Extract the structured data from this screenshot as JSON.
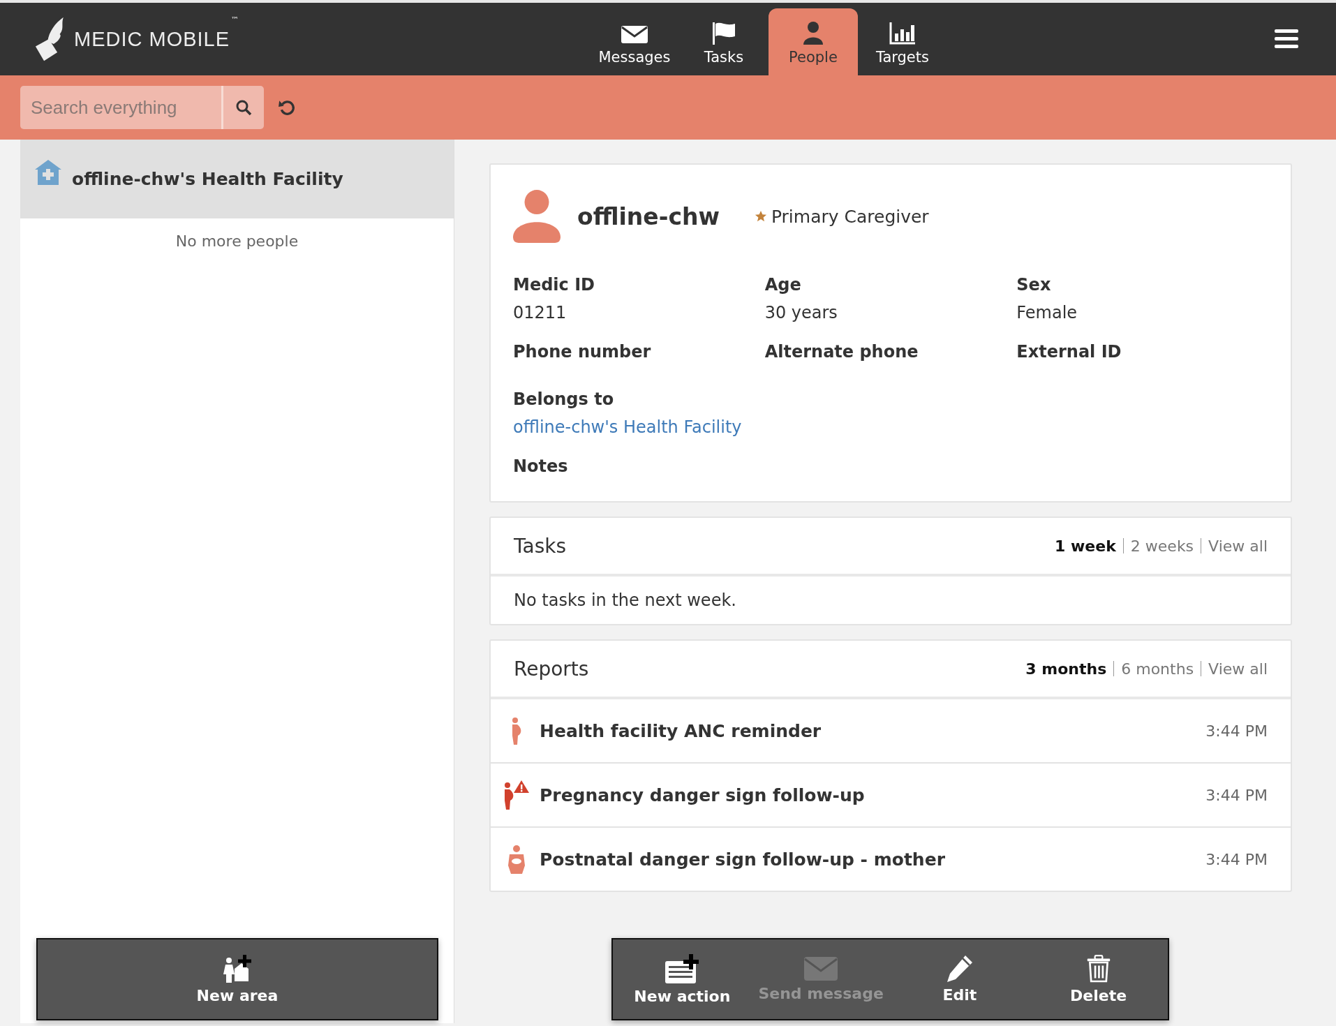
{
  "brand": {
    "name": "MEDIC MOBILE",
    "mark": "™"
  },
  "nav": [
    {
      "label": "Messages",
      "selected": false
    },
    {
      "label": "Tasks",
      "selected": false
    },
    {
      "label": "People",
      "selected": true
    },
    {
      "label": "Targets",
      "selected": false
    }
  ],
  "search": {
    "placeholder": "Search everything"
  },
  "left_panel": {
    "place": {
      "name": "offline-chw's Health Facility",
      "selected": true
    },
    "empty_note": "No more people",
    "actions": [
      {
        "label": "New area",
        "disabled": false
      }
    ]
  },
  "contact": {
    "name": "offline-chw",
    "role": "Primary Caregiver",
    "fields": [
      {
        "label": "Medic ID",
        "value": "01211"
      },
      {
        "label": "Age",
        "value": "30 years"
      },
      {
        "label": "Sex",
        "value": "Female"
      },
      {
        "label": "Phone number"
      },
      {
        "label": "Alternate phone"
      },
      {
        "label": "External ID"
      }
    ],
    "belongs_to": {
      "label": "Belongs to",
      "link": "offline-chw's Health Facility"
    },
    "notes": {
      "label": "Notes"
    }
  },
  "tasks": {
    "title": "Tasks",
    "filters": [
      {
        "label": "1 week",
        "selected": true
      },
      {
        "label": "2 weeks",
        "selected": false
      },
      {
        "label": "View all",
        "selected": false
      }
    ],
    "empty": "No tasks in the next week."
  },
  "reports": {
    "title": "Reports",
    "filters": [
      {
        "label": "3 months",
        "selected": true
      },
      {
        "label": "6 months",
        "selected": false
      },
      {
        "label": "View all",
        "selected": false
      }
    ],
    "items": [
      {
        "title": "Health facility ANC reminder",
        "time": "3:44 PM"
      },
      {
        "title": "Pregnancy danger sign follow-up",
        "time": "3:44 PM"
      },
      {
        "title": "Postnatal danger sign follow-up - mother",
        "time": "3:44 PM"
      }
    ]
  },
  "actions": [
    {
      "label": "New action",
      "disabled": false
    },
    {
      "label": "Send message",
      "disabled": true
    },
    {
      "label": "Edit",
      "disabled": false
    },
    {
      "label": "Delete",
      "disabled": false
    }
  ]
}
